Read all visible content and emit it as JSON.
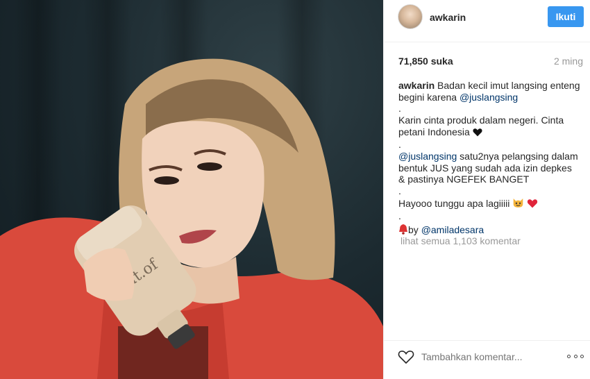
{
  "post": {
    "username": "awkarin",
    "follow_label": "Ikuti",
    "likes": "71,850 suka",
    "time_ago": "2 ming",
    "caption": {
      "user": "awkarin",
      "line1": " Badan kecil imut langsing enteng begini karena ",
      "mention1": "@juslangsing",
      "dot1": ".",
      "line2": "Karin cinta produk dalam negeri. Cinta petani Indonesia ",
      "dot2": ".",
      "mention2": "@juslangsing",
      "line3": " satu2nya pelangsing dalam bentuk JUS yang sudah ada izin depkes & pastinya NGEFEK BANGET",
      "dot3": ".",
      "line4": "Hayooo tunggu apa lagiiiii ",
      "dot4": ".",
      "credit_prefix": "by ",
      "credit_mention": "@amiladesara"
    },
    "view_comments": "lihat semua 1,103 komentar",
    "comment_placeholder": "Tambahkan komentar..."
  },
  "icons": {
    "like": "heart-outline-icon",
    "more": "more-options-icon",
    "black_heart": "black-heart-emoji",
    "red_heart": "red-heart-emoji",
    "cat": "cat-emoji",
    "bell": "bell-emoji"
  },
  "colors": {
    "accent": "#3897f0",
    "mention": "#003569",
    "muted": "#999999"
  }
}
